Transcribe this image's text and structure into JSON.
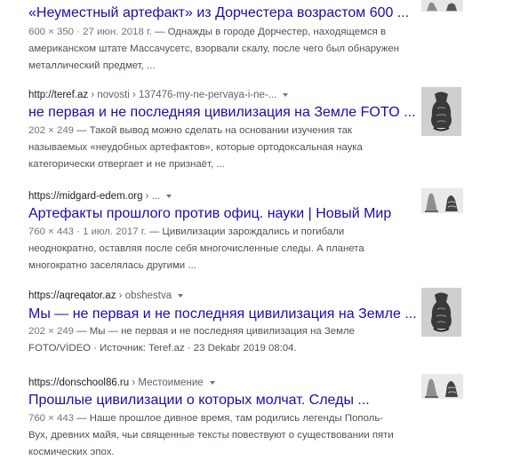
{
  "results": [
    {
      "title": "«Неуместный артефакт» из Дорчестера возрастом 600 ...",
      "meta": "600 × 350 · 27 июн. 2018 г.",
      "snippet": " — Однажды в городе Дорчестер, находящемся в американском штате Массачусетс, взорвали скалу, после чего был обнаружен металлический предмет, ...",
      "thumb_icon": "bell-vase-thumbnail-icon"
    },
    {
      "site": "http://teref.az",
      "path": " › novosti › 137476-my-ne-pervaya-i-ne-...",
      "title": "не первая и не последняя цивилизация на Земле FOTO ...",
      "meta": "202 × 249",
      "snippet": " — Такой вывод можно сделать на основании изучения так называемых «неудобных артефактов», которые ортодоксальная наука категорически отвергает и не признаёт, ...",
      "thumb_icon": "vase-sketch-thumbnail-icon"
    },
    {
      "site": "https://midgard-edem.org",
      "path": " › ...",
      "title": "Артефакты прошлого против офиц. науки | Новый Мир",
      "meta": "760 × 443 · 1 июл. 2017 г.",
      "snippet": " — Цивилизации зарождались и погибали неоднократно, оставляя после себя многочисленные следы. А планета многократно заселялась другими ...",
      "thumb_icon": "bell-vase-thumbnail-icon"
    },
    {
      "site": "https://aqreqator.az",
      "path": " › obshestva",
      "title": "Мы — не первая и не последняя цивилизация на Земле ...",
      "meta": "202 × 249",
      "snippet": " — Мы — не первая и не последняя цивилизация на Земле FOTO/VİDEO · Источник: Teref.az · 23 Dekabr 2019 08:04.",
      "thumb_icon": "vase-sketch-thumbnail-icon"
    },
    {
      "site": "https://donschool86.ru",
      "path": " › Местоимение",
      "title": "Прошлые цивилизации о которых молчат. Следы ...",
      "meta": "760 × 443",
      "snippet": " — Наше прошлое дивное время, там родились легенды Пополь-Вух, древних майя, чьи священные тексты повествуют о существовании пяти космических эпох.",
      "thumb_icon": "bell-vase-thumbnail-icon"
    }
  ]
}
